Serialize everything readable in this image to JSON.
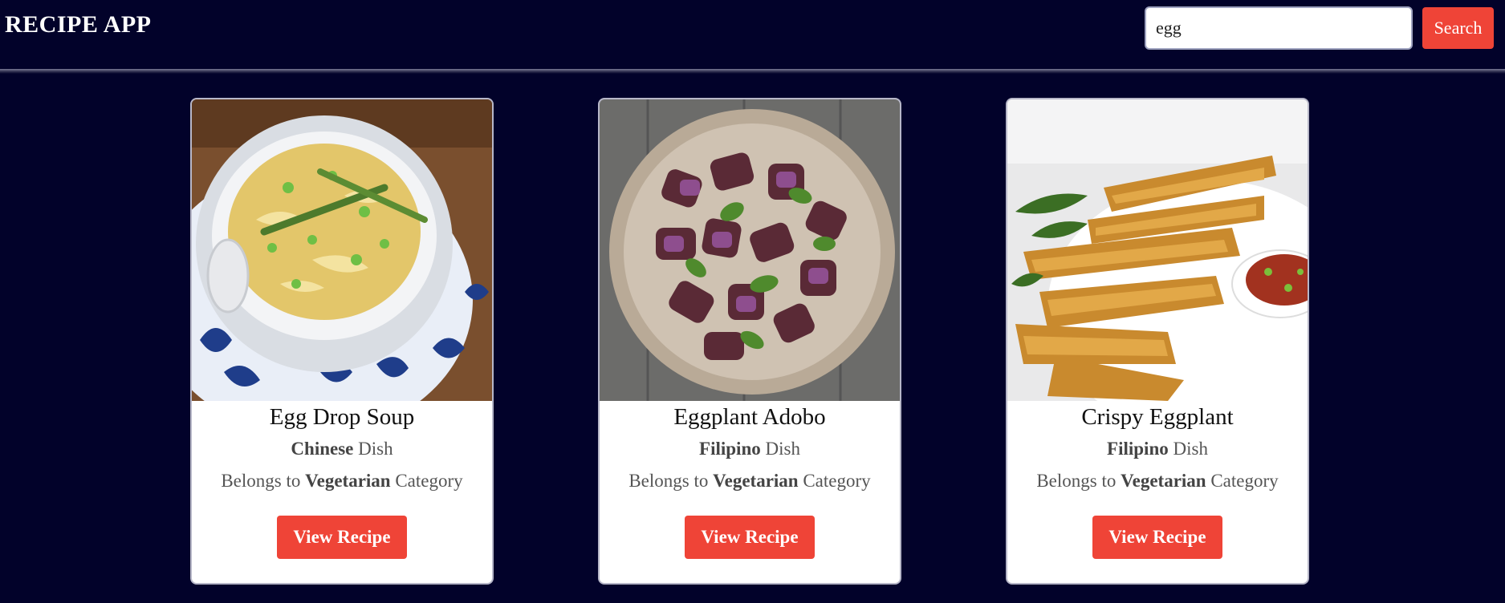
{
  "header": {
    "title": "RECIPE APP",
    "search": {
      "value": "egg",
      "placeholder": ""
    },
    "search_label": "Search"
  },
  "colors": {
    "background": "#02022a",
    "accent": "#ef4437",
    "card": "#ffffff"
  },
  "recipes": [
    {
      "title": "Egg Drop Soup",
      "cuisine": "Chinese",
      "dish_word": "Dish",
      "belongs": "Belongs to",
      "category": "Vegetarian",
      "category_word": "Category",
      "button": "View Recipe",
      "image": "egg-drop-soup-bowl"
    },
    {
      "title": "Eggplant Adobo",
      "cuisine": "Filipino",
      "dish_word": "Dish",
      "belongs": "Belongs to",
      "category": "Vegetarian",
      "category_word": "Category",
      "button": "View Recipe",
      "image": "eggplant-adobo-plate"
    },
    {
      "title": "Crispy Eggplant",
      "cuisine": "Filipino",
      "dish_word": "Dish",
      "belongs": "Belongs to",
      "category": "Vegetarian",
      "category_word": "Category",
      "button": "View Recipe",
      "image": "crispy-eggplant-fries"
    }
  ]
}
